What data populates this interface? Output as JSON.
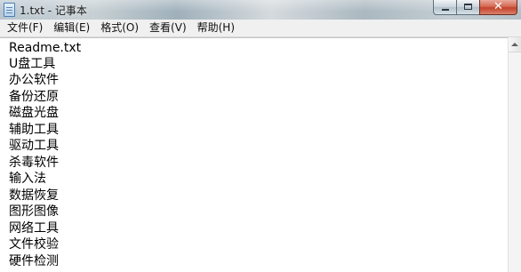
{
  "window": {
    "title": "1.txt - 记事本"
  },
  "menubar": {
    "items": [
      {
        "label": "文件(F)"
      },
      {
        "label": "编辑(E)"
      },
      {
        "label": "格式(O)"
      },
      {
        "label": "查看(V)"
      },
      {
        "label": "帮助(H)"
      }
    ]
  },
  "editor": {
    "lines": [
      "Readme.txt",
      "U盘工具",
      "办公软件",
      "备份还原",
      "磁盘光盘",
      "辅助工具",
      "驱动工具",
      "杀毒软件",
      "输入法",
      "数据恢复",
      "图形图像",
      "网络工具",
      "文件校验",
      "硬件检测"
    ]
  },
  "colors": {
    "menubar_bg": "#f0f0f0",
    "editor_bg": "#ffffff",
    "close_button": "#c4432a"
  },
  "icons": {
    "app": "notepad-icon",
    "minimize": "minimize-icon",
    "maximize": "maximize-icon",
    "close": "close-icon"
  }
}
